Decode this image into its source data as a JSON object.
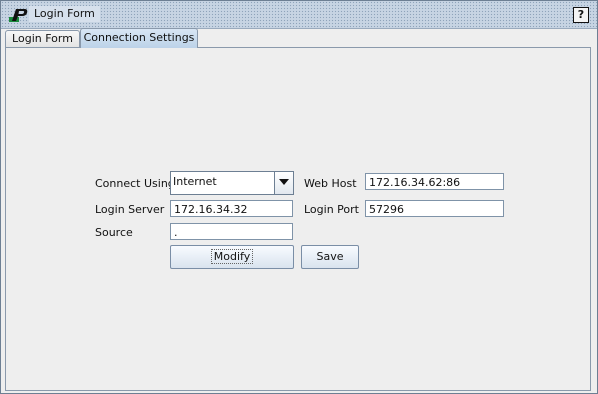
{
  "window": {
    "title": "Login Form",
    "help_label": "?"
  },
  "tabs": [
    {
      "label": "Login Form",
      "active": false
    },
    {
      "label": "Connection Settings",
      "active": true
    }
  ],
  "form": {
    "connect_using": {
      "label": "Connect Using",
      "value": "Internet"
    },
    "web_host": {
      "label": "Web Host",
      "value": "172.16.34.62:86"
    },
    "login_server": {
      "label": "Login Server",
      "value": "172.16.34.32"
    },
    "login_port": {
      "label": "Login Port",
      "value": "57296"
    },
    "source": {
      "label": "Source",
      "value": "."
    },
    "modify_label": "Modify",
    "save_label": "Save"
  },
  "icons": {
    "app": "app-logo-icon",
    "dropdown": "chevron-down-icon"
  }
}
